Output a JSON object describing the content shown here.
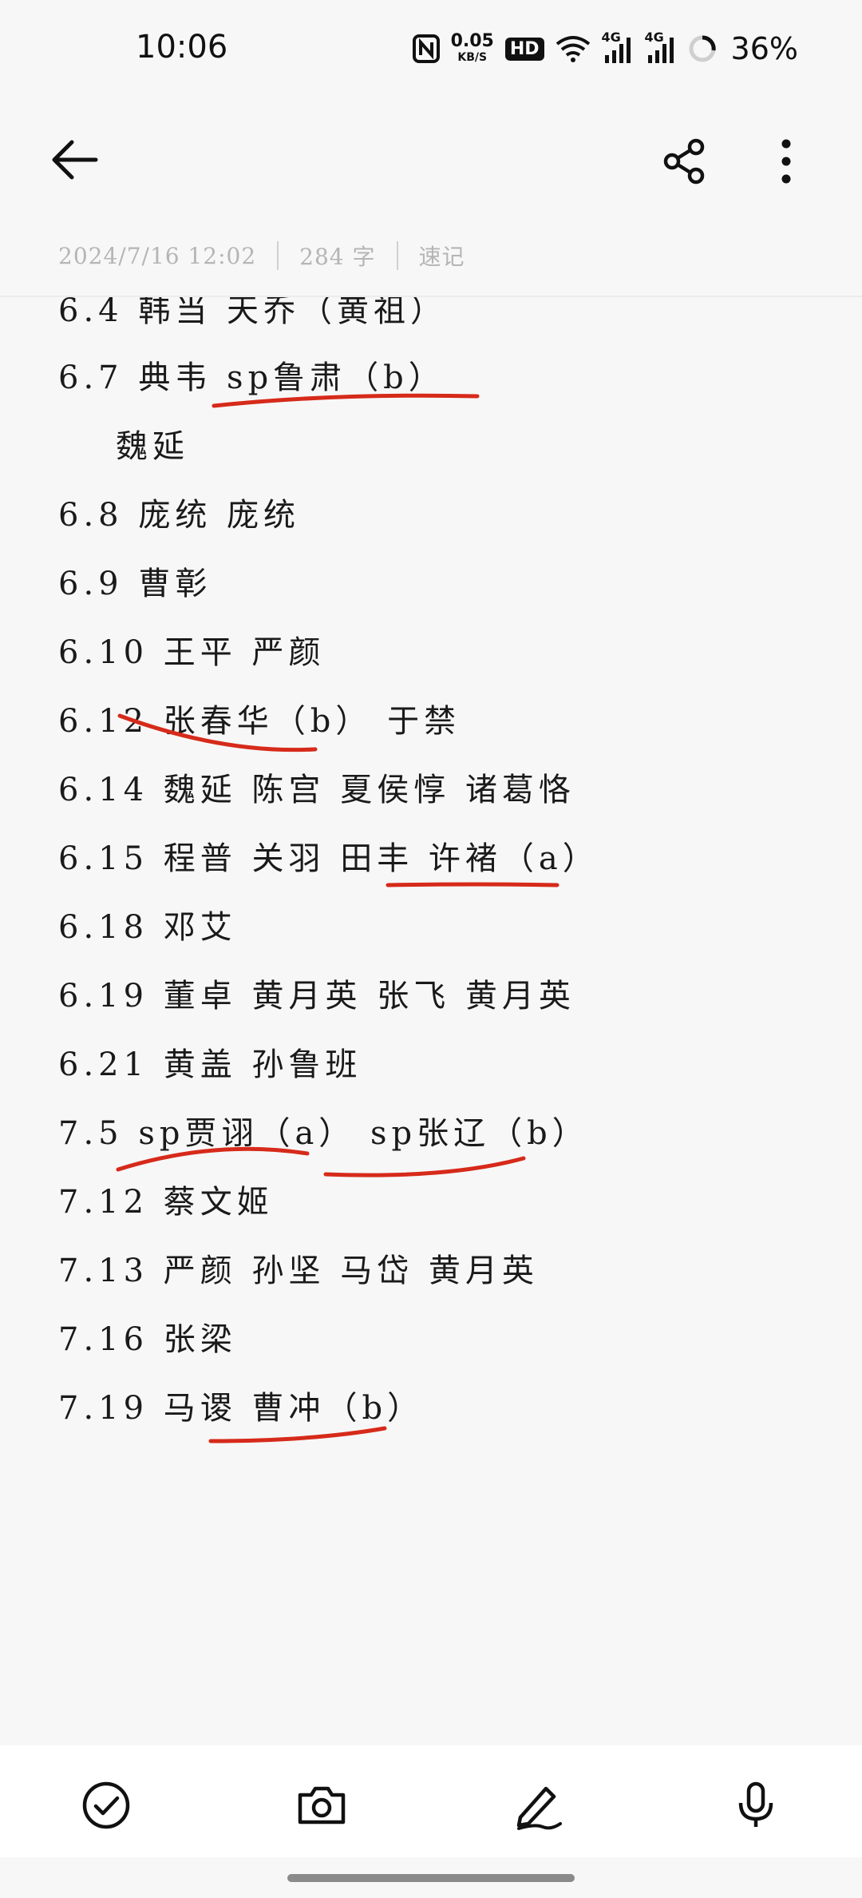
{
  "status_bar": {
    "time": "10:06",
    "network_speed_value": "0.05",
    "network_speed_unit": "KB/S",
    "hd_badge": "HD",
    "signal1_label": "4G",
    "signal2_label": "4G",
    "battery": "36%"
  },
  "meta": {
    "date": "2024/7/16 12:02",
    "word_count": "284 字",
    "category": "速记"
  },
  "note_lines": [
    "6.4 韩当 天乔（黄祖）",
    "6.7 典韦 sp鲁肃（b）",
    "魏延",
    "6.8 庞统 庞统",
    "6.9 曹彰",
    "6.10 王平 严颜",
    "6.12 张春华（b） 于禁",
    "6.14 魏延 陈宫 夏侯惇 诸葛恪",
    "6.15 程普 关羽 田丰 许褚（a）",
    "6.18 邓艾",
    "6.19 董卓 黄月英 张飞 黄月英",
    "6.21 黄盖 孙鲁班",
    "7.5 sp贾诩（a） sp张辽（b）",
    "7.12 蔡文姬",
    "7.13 严颜 孙坚 马岱 黄月英",
    "7.16 张梁",
    "7.19 马谡 曹冲（b）"
  ],
  "toolbar": {
    "checklist_icon": "check-circle-icon",
    "camera_icon": "camera-icon",
    "pen_icon": "pen-icon",
    "mic_icon": "mic-icon"
  },
  "colors": {
    "underline_ink": "#d62a1a",
    "background": "#f7f7f7"
  }
}
